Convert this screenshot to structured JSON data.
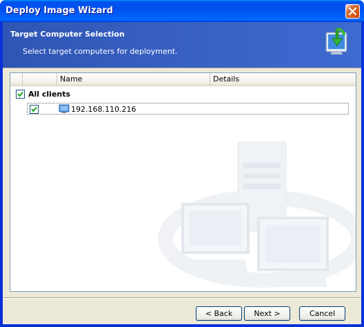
{
  "window": {
    "title": "Deploy Image Wizard"
  },
  "header": {
    "title": "Target Computer Selection",
    "subtitle": "Select target computers for deployment."
  },
  "list": {
    "columns": [
      "Name",
      "Details"
    ],
    "group": {
      "label": "All clients",
      "checked": true
    },
    "items": [
      {
        "label": "192.168.110.216",
        "checked": true
      }
    ]
  },
  "buttons": {
    "back": "< Back",
    "next": "Next >",
    "cancel": "Cancel"
  },
  "colors": {
    "titlebar": "#0054e3",
    "header": "#3a63c6",
    "face": "#ece9d8"
  }
}
